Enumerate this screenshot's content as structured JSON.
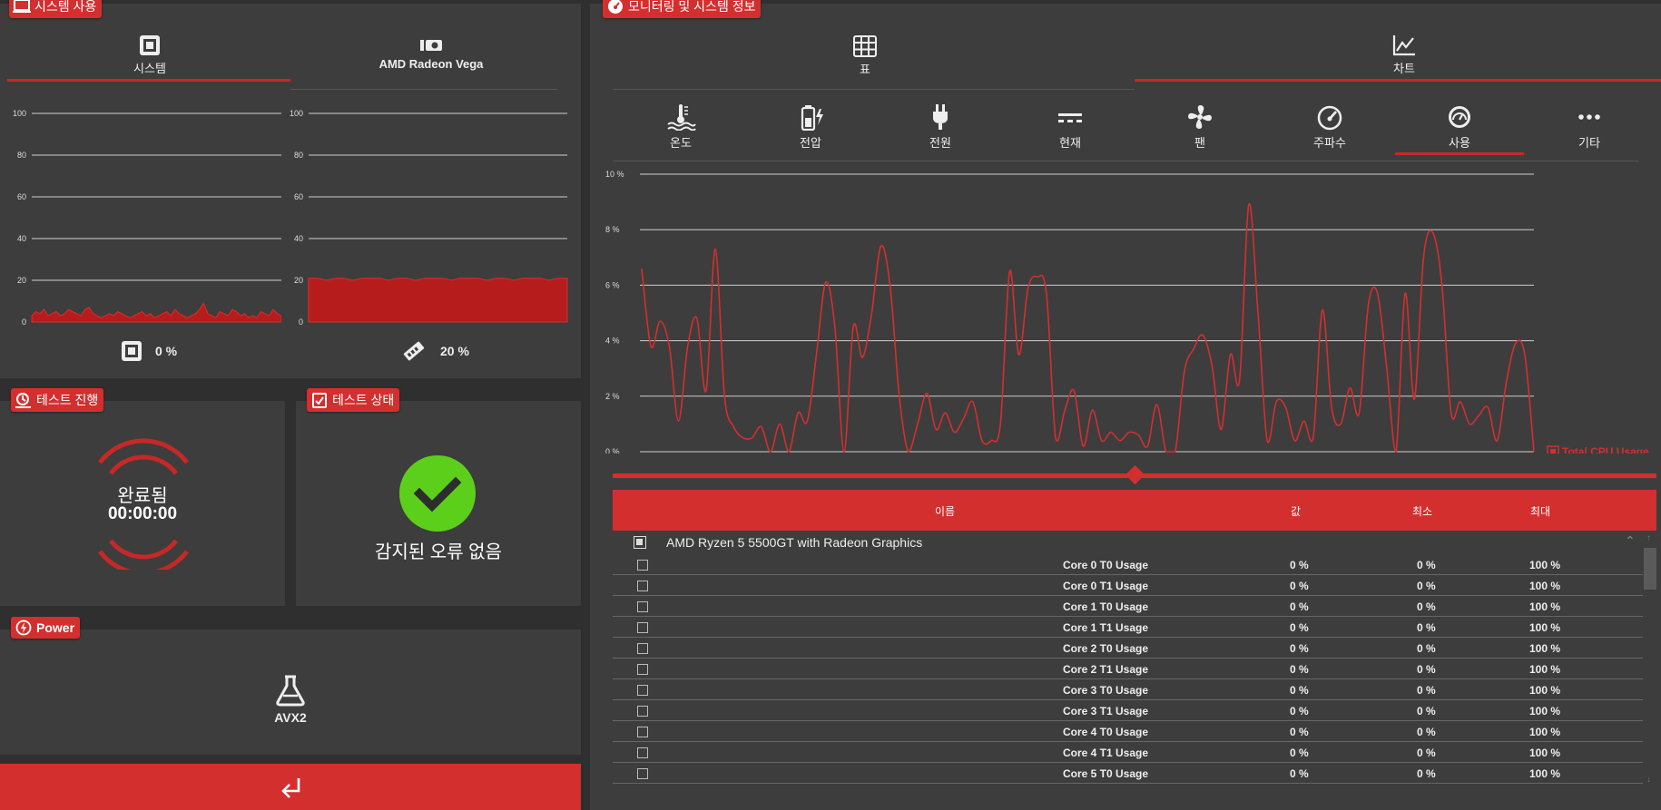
{
  "system_usage": {
    "badge": "시스템 사용",
    "tab_system": "시스템",
    "tab_gpu": "AMD Radeon Vega",
    "y_ticks": [
      "100",
      "80",
      "60",
      "40",
      "20",
      "0"
    ],
    "system_value": "0 %",
    "gpu_value": "20 %"
  },
  "test_progress": {
    "badge": "테스트 진행",
    "status": "완료됨",
    "time": "00:00:00"
  },
  "test_status": {
    "badge": "테스트 상태",
    "message": "감지된 오류 없음"
  },
  "power": {
    "badge": "Power",
    "mode": "AVX2"
  },
  "monitoring": {
    "badge": "모니터링 및 시스템 정보",
    "tab_table": "표",
    "tab_chart": "차트",
    "sensor_tabs": [
      "온도",
      "전압",
      "전원",
      "현재",
      "팬",
      "주파수",
      "사용",
      "기타"
    ],
    "active_sensor_tab": "사용",
    "legend": "Total CPU Usage",
    "y_ticks": [
      "10 %",
      "8 %",
      "6 %",
      "4 %",
      "2 %",
      "0 %"
    ]
  },
  "table": {
    "headers": {
      "name": "이름",
      "value": "값",
      "min": "최소",
      "max": "최대"
    },
    "group": "AMD Ryzen 5 5500GT with Radeon Graphics",
    "rows": [
      {
        "name": "Core 0 T0 Usage",
        "value": "0 %",
        "min": "0 %",
        "max": "100 %"
      },
      {
        "name": "Core 0 T1 Usage",
        "value": "0 %",
        "min": "0 %",
        "max": "100 %"
      },
      {
        "name": "Core 1 T0 Usage",
        "value": "0 %",
        "min": "0 %",
        "max": "100 %"
      },
      {
        "name": "Core 1 T1 Usage",
        "value": "0 %",
        "min": "0 %",
        "max": "100 %"
      },
      {
        "name": "Core 2 T0 Usage",
        "value": "0 %",
        "min": "0 %",
        "max": "100 %"
      },
      {
        "name": "Core 2 T1 Usage",
        "value": "0 %",
        "min": "0 %",
        "max": "100 %"
      },
      {
        "name": "Core 3 T0 Usage",
        "value": "0 %",
        "min": "0 %",
        "max": "100 %"
      },
      {
        "name": "Core 3 T1 Usage",
        "value": "0 %",
        "min": "0 %",
        "max": "100 %"
      },
      {
        "name": "Core 4 T0 Usage",
        "value": "0 %",
        "min": "0 %",
        "max": "100 %"
      },
      {
        "name": "Core 4 T1 Usage",
        "value": "0 %",
        "min": "0 %",
        "max": "100 %"
      },
      {
        "name": "Core 5 T0 Usage",
        "value": "0 %",
        "min": "0 %",
        "max": "100 %"
      }
    ]
  },
  "colors": {
    "accent": "#d32f2f",
    "panel": "#3d3d3d",
    "background": "#2f2f2f",
    "ok": "#5ccf1a"
  },
  "chart_data": [
    {
      "type": "area",
      "series": [
        {
          "values": [
            3,
            5,
            4,
            6,
            3,
            4,
            5,
            3,
            4,
            6,
            5,
            4,
            3,
            6,
            7,
            4,
            3,
            2,
            3,
            4,
            3,
            5,
            4,
            3,
            2,
            3,
            4,
            5,
            3,
            4,
            2,
            3,
            4,
            5,
            3,
            6,
            4,
            3,
            2,
            3,
            4,
            6,
            9,
            4,
            3,
            2,
            5,
            4,
            3,
            6,
            5,
            3,
            4,
            2,
            3,
            2,
            5,
            4,
            3,
            6,
            4,
            3
          ]
        }
      ],
      "ylim": [
        0,
        100
      ]
    },
    {
      "type": "area",
      "series": [
        {
          "values": [
            21,
            21,
            20,
            21,
            21,
            20,
            21,
            21,
            21,
            20,
            21,
            21,
            20,
            21,
            21,
            21,
            20,
            21,
            21,
            21,
            20,
            21,
            21,
            20,
            21,
            21,
            21,
            20,
            21,
            21
          ]
        }
      ],
      "ylim": [
        0,
        100
      ]
    },
    {
      "type": "line",
      "series": [
        {
          "name": "Total CPU Usage",
          "values": [
            6.6,
            3.8,
            4.7,
            3.8,
            1.1,
            3.8,
            4.8,
            2.2,
            7.3,
            2.0,
            0.9,
            0.5,
            0.5,
            0.9,
            0,
            1.0,
            0,
            1.4,
            1.1,
            3.5,
            6.1,
            4.5,
            0,
            4.5,
            3.4,
            5.0,
            7.4,
            6.0,
            2.0,
            0,
            1.0,
            2.1,
            0.8,
            1.4,
            0.7,
            1.2,
            1.8,
            0.4,
            0.4,
            1.0,
            6.5,
            3.5,
            5.9,
            6.3,
            5.7,
            0.5,
            1.5,
            2.2,
            0.2,
            1.5,
            0.4,
            0.7,
            0.4,
            0.7,
            0.6,
            0.2,
            1.7,
            0,
            0,
            2.9,
            3.7,
            4.2,
            3.1,
            0.8,
            3.5,
            2.6,
            8.9,
            5.0,
            0.4,
            1.8,
            1.6,
            0.4,
            1.1,
            0.5,
            5.1,
            1.6,
            1.0,
            2.3,
            1.4,
            5.3,
            5.7,
            3.0,
            0,
            5.7,
            1.9,
            7.0,
            7.9,
            6.0,
            1.4,
            1.8,
            1.0,
            1.3,
            1.6,
            0.4,
            2.5,
            3.9,
            3.5,
            0
          ]
        }
      ],
      "ylim": [
        0,
        10
      ],
      "yticks": [
        "10 %",
        "8 %",
        "6 %",
        "4 %",
        "2 %",
        "0 %"
      ],
      "legend": "Total CPU Usage"
    }
  ]
}
